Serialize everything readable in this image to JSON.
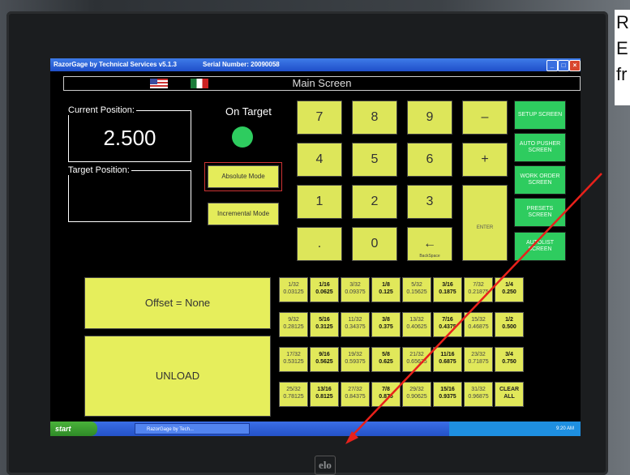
{
  "window": {
    "app_title": "RazorGage by Technical Services  v5.1.3",
    "serial": "Serial Number: 20090058"
  },
  "header": {
    "title": "Main Screen"
  },
  "current_position": {
    "label": "Current Position:",
    "value": "2.500"
  },
  "target_position": {
    "label": "Target Position:",
    "value": ""
  },
  "status": {
    "label": "On Target",
    "indicator_color": "#2ecc5f"
  },
  "modes": {
    "absolute": "Absolute Mode",
    "incremental": "Incremental Mode"
  },
  "keypad": {
    "keys": [
      "7",
      "8",
      "9",
      "–",
      "4",
      "5",
      "6",
      "+",
      "1",
      "2",
      "3",
      "",
      "",
      "0",
      "←",
      ""
    ],
    "dot": ".",
    "backspace_sub": "BackSpace",
    "enter": "ENTER"
  },
  "side_buttons": [
    "SETUP SCREEN",
    "AUTO PUSHER SCREEN",
    "WORK ORDER SCREEN",
    "PRESETS SCREEN",
    "AUTOLIST SCREEN"
  ],
  "offset": "Offset = None",
  "unload": "UNLOAD",
  "fractions": [
    [
      "1/32",
      "0.03125"
    ],
    [
      "1/16",
      "0.0625"
    ],
    [
      "3/32",
      "0.09375"
    ],
    [
      "1/8",
      "0.125"
    ],
    [
      "5/32",
      "0.15625"
    ],
    [
      "3/16",
      "0.1875"
    ],
    [
      "7/32",
      "0.21875"
    ],
    [
      "1/4",
      "0.250"
    ],
    [
      "9/32",
      "0.28125"
    ],
    [
      "5/16",
      "0.3125"
    ],
    [
      "11/32",
      "0.34375"
    ],
    [
      "3/8",
      "0.375"
    ],
    [
      "13/32",
      "0.40625"
    ],
    [
      "7/16",
      "0.4375"
    ],
    [
      "15/32",
      "0.46875"
    ],
    [
      "1/2",
      "0.500"
    ],
    [
      "17/32",
      "0.53125"
    ],
    [
      "9/16",
      "0.5625"
    ],
    [
      "19/32",
      "0.59375"
    ],
    [
      "5/8",
      "0.625"
    ],
    [
      "21/32",
      "0.65625"
    ],
    [
      "11/16",
      "0.6875"
    ],
    [
      "23/32",
      "0.71875"
    ],
    [
      "3/4",
      "0.750"
    ],
    [
      "25/32",
      "0.78125"
    ],
    [
      "13/16",
      "0.8125"
    ],
    [
      "27/32",
      "0.84375"
    ],
    [
      "7/8",
      "0.875"
    ],
    [
      "29/32",
      "0.90625"
    ],
    [
      "15/16",
      "0.9375"
    ],
    [
      "31/32",
      "0.96875"
    ],
    [
      "CLEAR",
      "ALL"
    ]
  ],
  "taskbar": {
    "start": "start",
    "task": "RazorGage by Tech...",
    "clock": "9:20 AM"
  },
  "monitor_logo": "elo",
  "annotation": {
    "line1": "R",
    "line2": "E",
    "line3": "fr"
  }
}
